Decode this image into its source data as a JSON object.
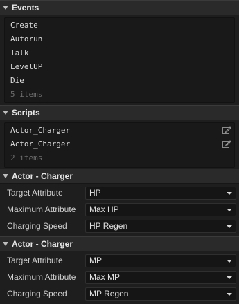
{
  "events": {
    "title": "Events",
    "items": [
      "Create",
      "Autorun",
      "Talk",
      "LevelUP",
      "Die"
    ],
    "count_text": "5 items"
  },
  "scripts": {
    "title": "Scripts",
    "items": [
      "Actor_Charger",
      "Actor_Charger"
    ],
    "count_text": "2 items",
    "edit_icon": "edit-icon"
  },
  "components": [
    {
      "title": "Actor - Charger",
      "rows": [
        {
          "label": "Target Attribute",
          "value": "HP"
        },
        {
          "label": "Maximum Attribute",
          "value": "Max HP"
        },
        {
          "label": "Charging Speed",
          "value": "HP Regen"
        }
      ]
    },
    {
      "title": "Actor - Charger",
      "rows": [
        {
          "label": "Target Attribute",
          "value": "MP"
        },
        {
          "label": "Maximum Attribute",
          "value": "Max MP"
        },
        {
          "label": "Charging Speed",
          "value": "MP Regen"
        }
      ]
    }
  ]
}
